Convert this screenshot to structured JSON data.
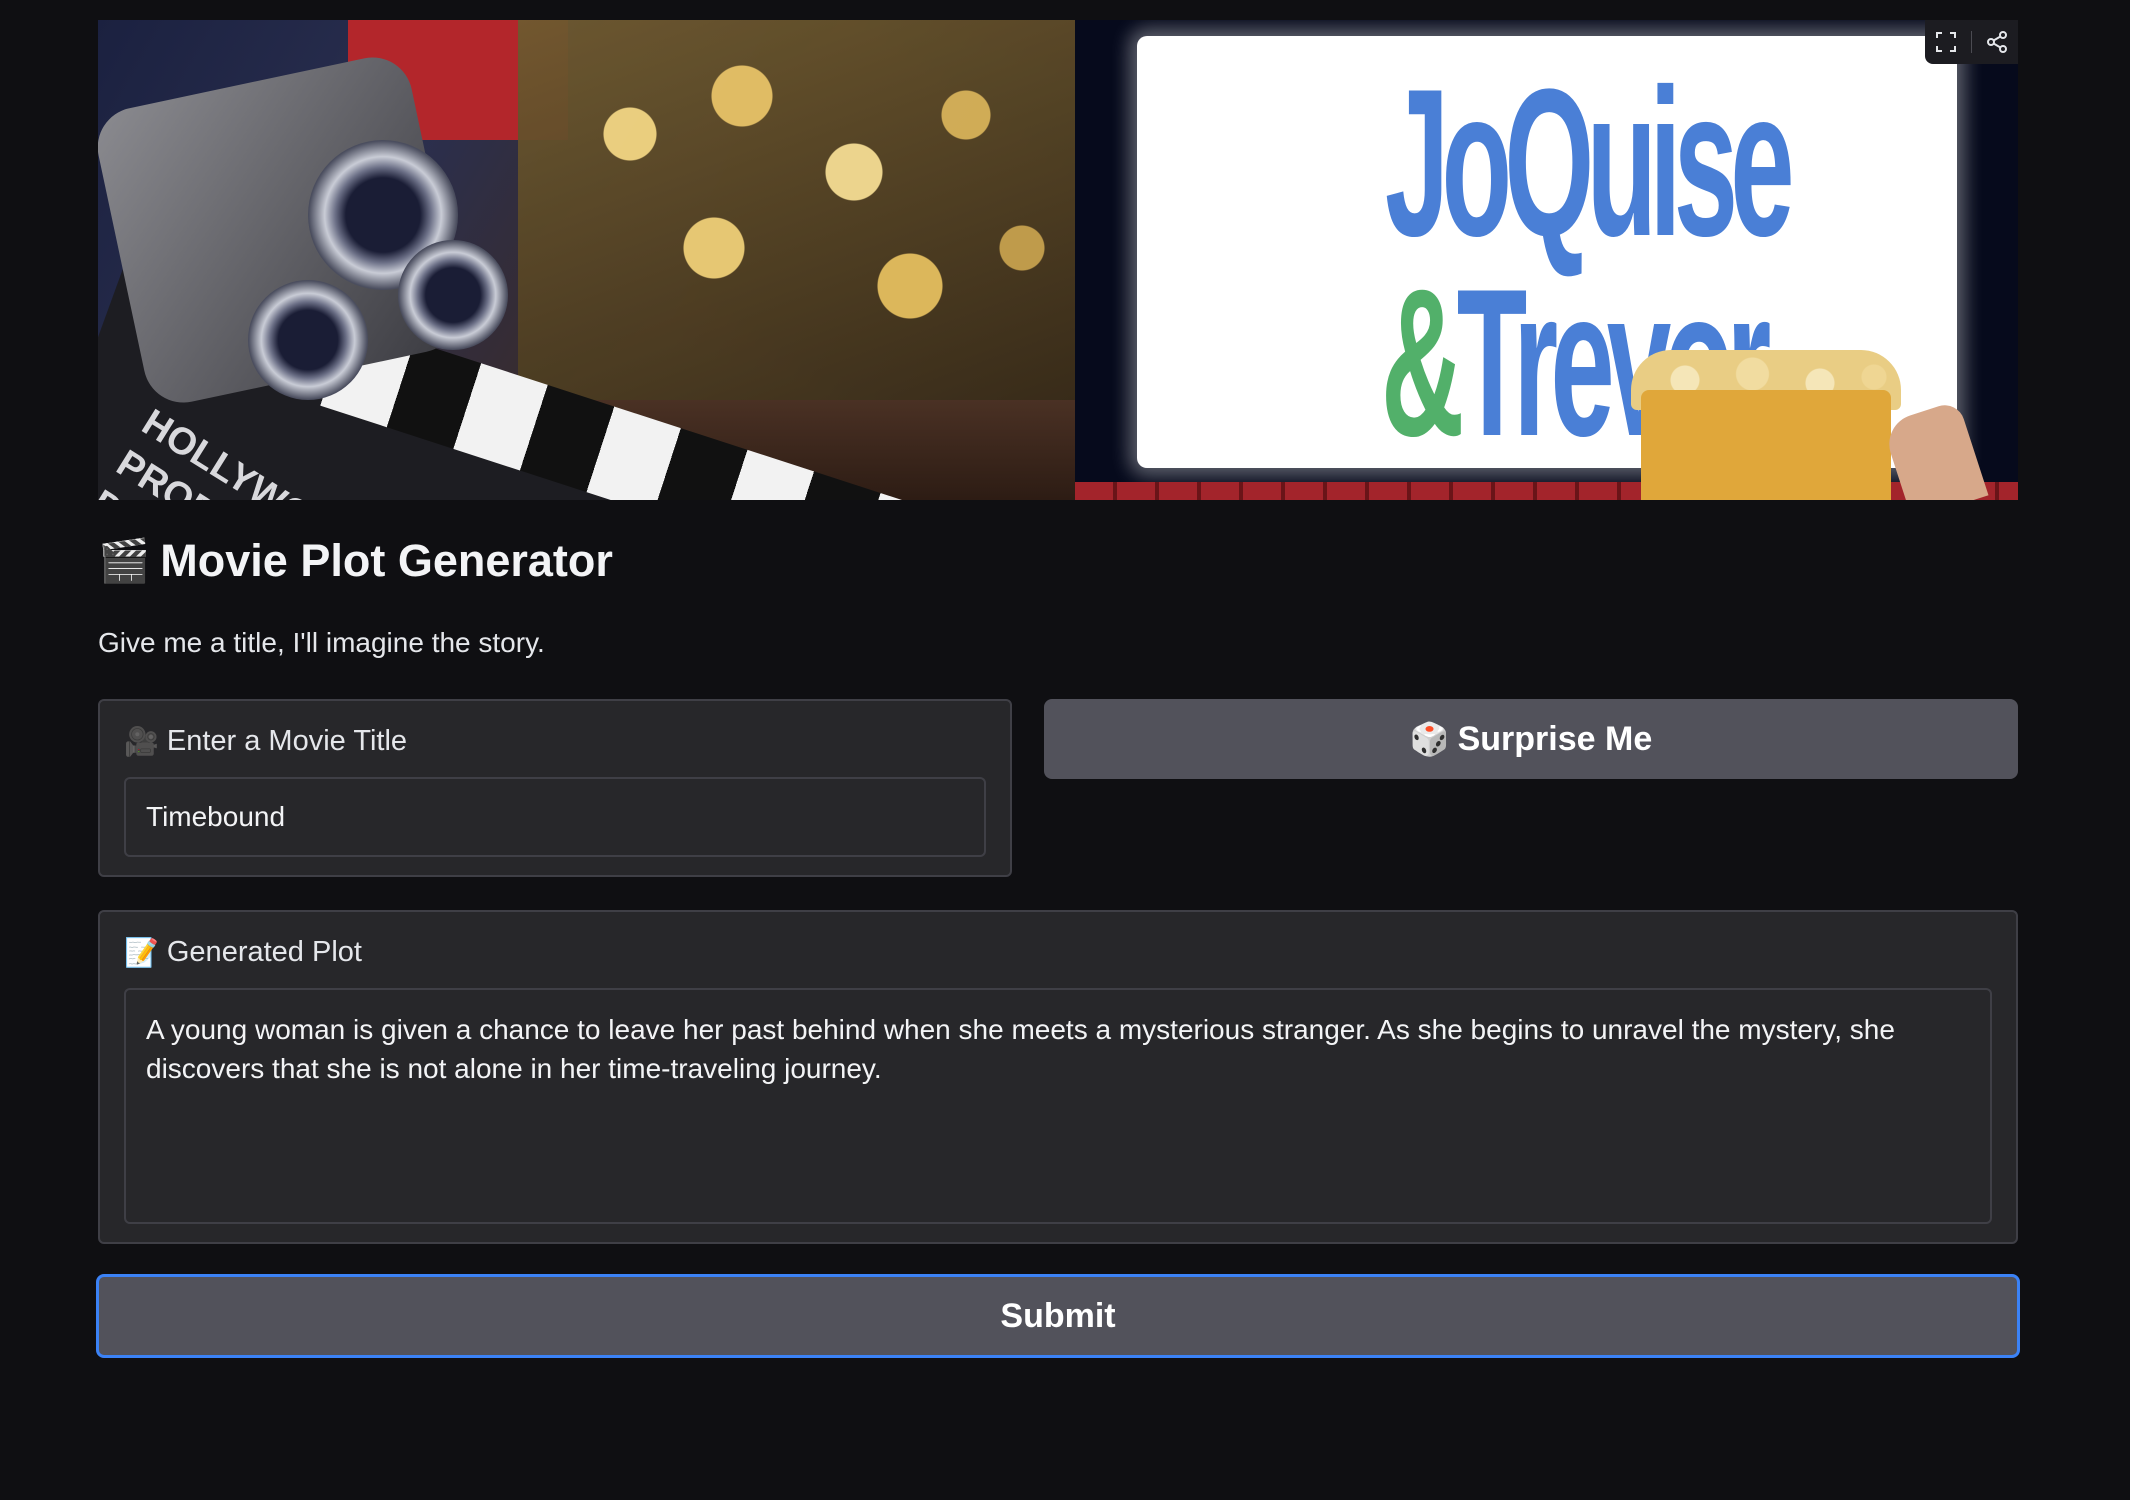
{
  "app": {
    "title": "Movie Plot Generator",
    "title_icon": "clapperboard-icon",
    "description": "Give me a title, I'll imagine the story."
  },
  "banner": {
    "logo_line1": "JoQuise",
    "logo_amp": "&",
    "logo_line2": "Trevor",
    "slate_text": "HOLLYWOOD\nPRODUCTION\nDIRECTOR\nCAMERA",
    "tools": [
      "fullscreen-icon",
      "share-icon"
    ]
  },
  "title_input": {
    "label": "Enter a Movie Title",
    "label_icon": "film-camera-icon",
    "value": "Timebound"
  },
  "surprise_button": {
    "label": "Surprise Me",
    "icon": "dice-icon"
  },
  "plot_output": {
    "label": "Generated Plot",
    "label_icon": "memo-icon",
    "value": "A young woman is given a chance to leave her past behind when she meets a mysterious stranger. As she begins to unravel the mystery, she discovers that she is not alone in her time-traveling journey."
  },
  "submit_button": {
    "label": "Submit"
  },
  "colors": {
    "background": "#0f0f12",
    "panel": "#27272a",
    "border": "#3f3f46",
    "button": "#52525b",
    "focus_ring": "#3b82f6",
    "logo_blue": "#4a7fd6",
    "logo_green": "#52b06a"
  }
}
